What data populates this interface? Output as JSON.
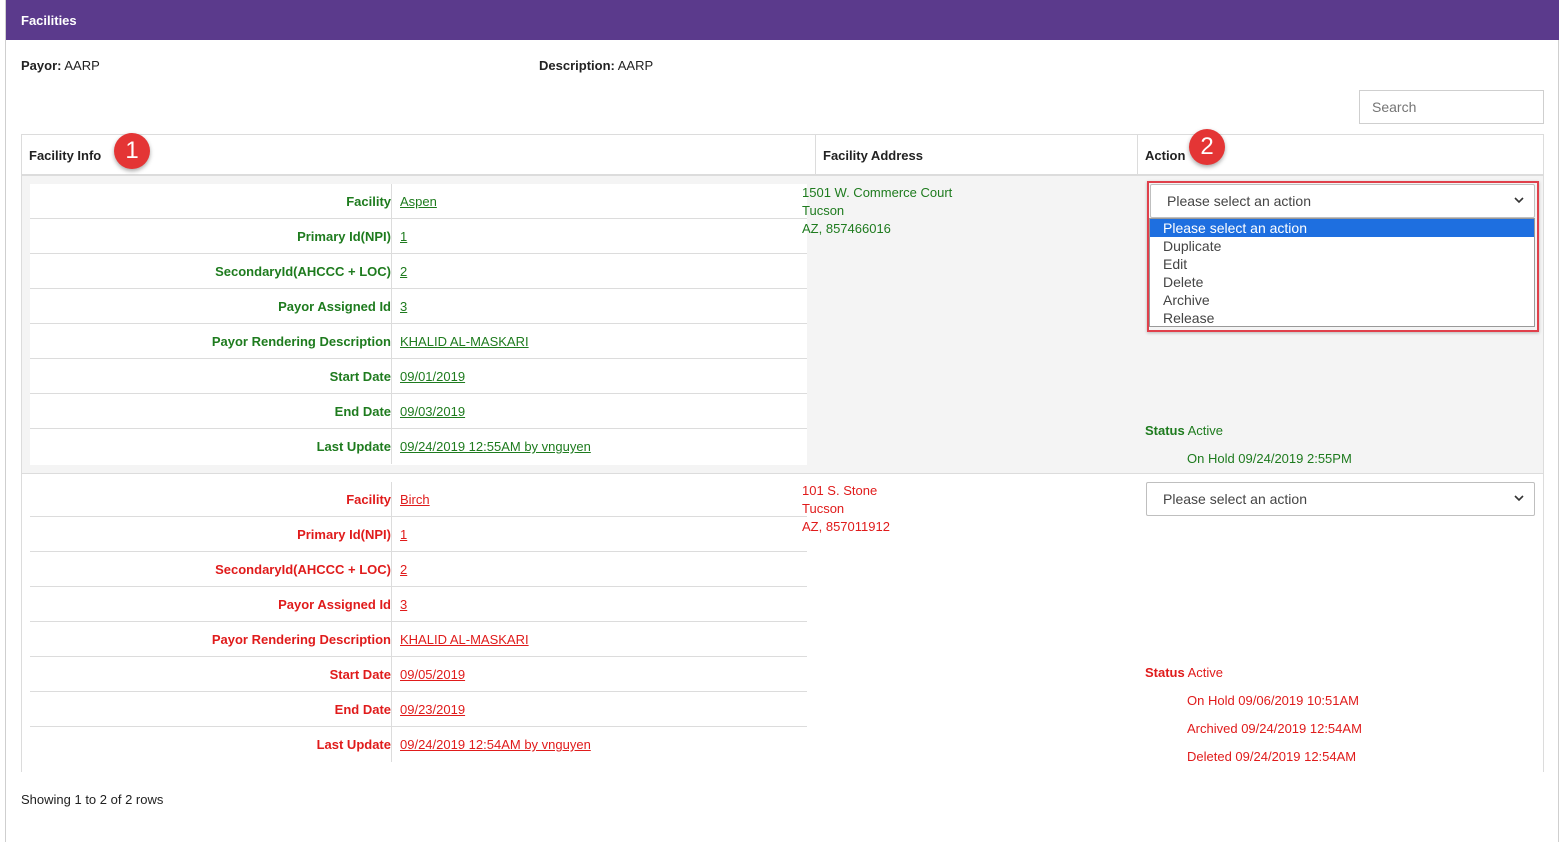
{
  "header": {
    "title": "Facilities"
  },
  "meta": {
    "payor_label": "Payor:",
    "payor_value": "AARP",
    "description_label": "Description:",
    "description_value": "AARP"
  },
  "search": {
    "placeholder": "Search"
  },
  "columns": {
    "facility_info": "Facility Info",
    "facility_address": "Facility Address",
    "action": "Action"
  },
  "badges": {
    "one": "1",
    "two": "2"
  },
  "rows": [
    {
      "color": "#1e7b1e",
      "fields": [
        {
          "label": "Facility",
          "value": "Aspen"
        },
        {
          "label": "Primary Id(NPI)",
          "value": "1"
        },
        {
          "label": "SecondaryId(AHCCC + LOC)",
          "value": "2"
        },
        {
          "label": "Payor Assigned Id",
          "value": "3"
        },
        {
          "label": "Payor Rendering Description",
          "value": "KHALID AL-MASKARI"
        },
        {
          "label": "Start Date",
          "value": "09/01/2019"
        },
        {
          "label": "End Date",
          "value": "09/03/2019"
        },
        {
          "label": "Last Update",
          "value": "09/24/2019 12:55AM by vnguyen"
        }
      ],
      "address": [
        "1501 W. Commerce Court",
        "Tucson",
        "AZ, 857466016"
      ],
      "select_value": "Please select an action",
      "status_label": "Status",
      "status_value": "Active",
      "history": [
        "On Hold 09/24/2019 2:55PM"
      ]
    },
    {
      "color": "#e01b1b",
      "fields": [
        {
          "label": "Facility",
          "value": "Birch"
        },
        {
          "label": "Primary Id(NPI)",
          "value": "1"
        },
        {
          "label": "SecondaryId(AHCCC + LOC)",
          "value": "2"
        },
        {
          "label": "Payor Assigned Id",
          "value": "3"
        },
        {
          "label": "Payor Rendering Description",
          "value": "KHALID AL-MASKARI"
        },
        {
          "label": "Start Date",
          "value": "09/05/2019"
        },
        {
          "label": "End Date",
          "value": "09/23/2019"
        },
        {
          "label": "Last Update",
          "value": "09/24/2019 12:54AM by vnguyen"
        }
      ],
      "address": [
        "101 S. Stone",
        "Tucson",
        "AZ, 857011912"
      ],
      "select_value": "Please select an action",
      "status_label": "Status",
      "status_value": "Active",
      "history": [
        "On Hold 09/06/2019 10:51AM",
        "Archived 09/24/2019 12:54AM",
        "Deleted 09/24/2019 12:54AM"
      ]
    }
  ],
  "dropdown_options": [
    "Please select an action",
    "Duplicate",
    "Edit",
    "Delete",
    "Archive",
    "Release"
  ],
  "footer": {
    "text": "Showing 1 to 2 of 2 rows"
  }
}
